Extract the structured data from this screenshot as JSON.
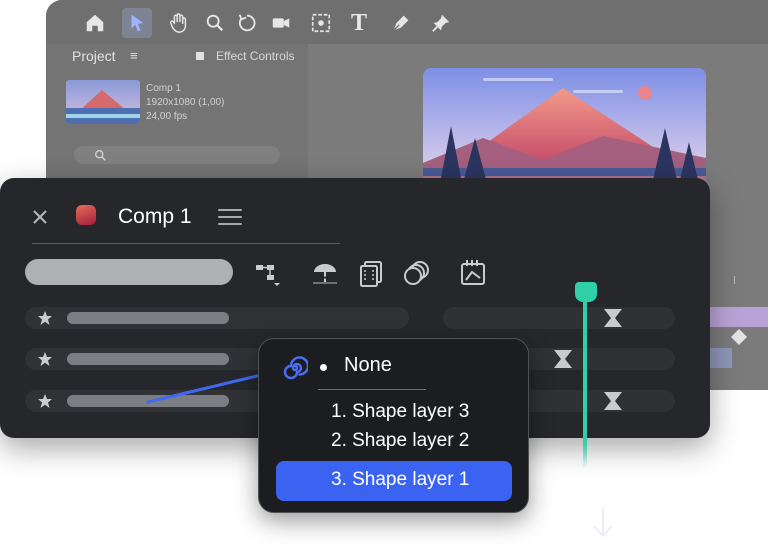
{
  "app": {
    "project_tab": "Project",
    "project_menu": "≡",
    "effect_tab": "Effect Controls",
    "comp_name_small": "Comp 1",
    "comp_resolution": "1920x1080 (1,00)",
    "comp_fps": "24,00 fps",
    "toolbar_text_tool": "T"
  },
  "panel": {
    "title": "Comp 1",
    "close": "✕",
    "layers": [
      "",
      "",
      ""
    ]
  },
  "dropdown": {
    "none_label": "None",
    "options": [
      "1. Shape layer 3",
      "2. Shape layer 2",
      "3. Shape layer 1"
    ],
    "selected_index": 2
  },
  "colors": {
    "accent_blue": "#3b63f2",
    "playhead": "#2fd0a8",
    "panel_bg": "#25272b",
    "comp_color": "#d0364a"
  }
}
